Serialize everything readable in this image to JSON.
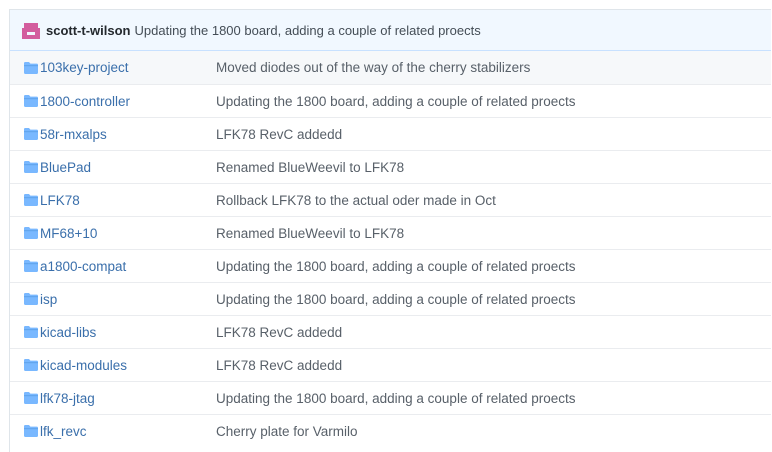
{
  "commit": {
    "author": "scott-t-wilson",
    "message": "Updating the 1800 board, adding a couple of related proects"
  },
  "colors": {
    "link": "#3a6fab",
    "folder": "#79b8ff",
    "avatar": "#d35d9e",
    "header_bg": "#f1f8ff"
  },
  "rows": [
    {
      "icon": "folder-icon",
      "name": "103key-project",
      "message": "Moved diodes out of the way of the cherry stabilizers"
    },
    {
      "icon": "folder-icon",
      "name": "1800-controller",
      "message": "Updating the 1800 board, adding a couple of related proects"
    },
    {
      "icon": "folder-icon",
      "name": "58r-mxalps",
      "message": "LFK78 RevC addedd"
    },
    {
      "icon": "folder-icon",
      "name": "BluePad",
      "message": "Renamed BlueWeevil to LFK78"
    },
    {
      "icon": "folder-icon",
      "name": "LFK78",
      "message": "Rollback LFK78 to the actual oder made in Oct"
    },
    {
      "icon": "folder-icon",
      "name": "MF68+10",
      "message": "Renamed BlueWeevil to LFK78"
    },
    {
      "icon": "folder-icon",
      "name": "a1800-compat",
      "message": "Updating the 1800 board, adding a couple of related proects"
    },
    {
      "icon": "folder-icon",
      "name": "isp",
      "message": "Updating the 1800 board, adding a couple of related proects"
    },
    {
      "icon": "folder-icon",
      "name": "kicad-libs",
      "message": "LFK78 RevC addedd"
    },
    {
      "icon": "folder-icon",
      "name": "kicad-modules",
      "message": "LFK78 RevC addedd"
    },
    {
      "icon": "folder-icon",
      "name": "lfk78-jtag",
      "message": "Updating the 1800 board, adding a couple of related proects"
    },
    {
      "icon": "folder-icon",
      "name": "lfk_revc",
      "message": "Cherry plate for Varmilo"
    }
  ]
}
